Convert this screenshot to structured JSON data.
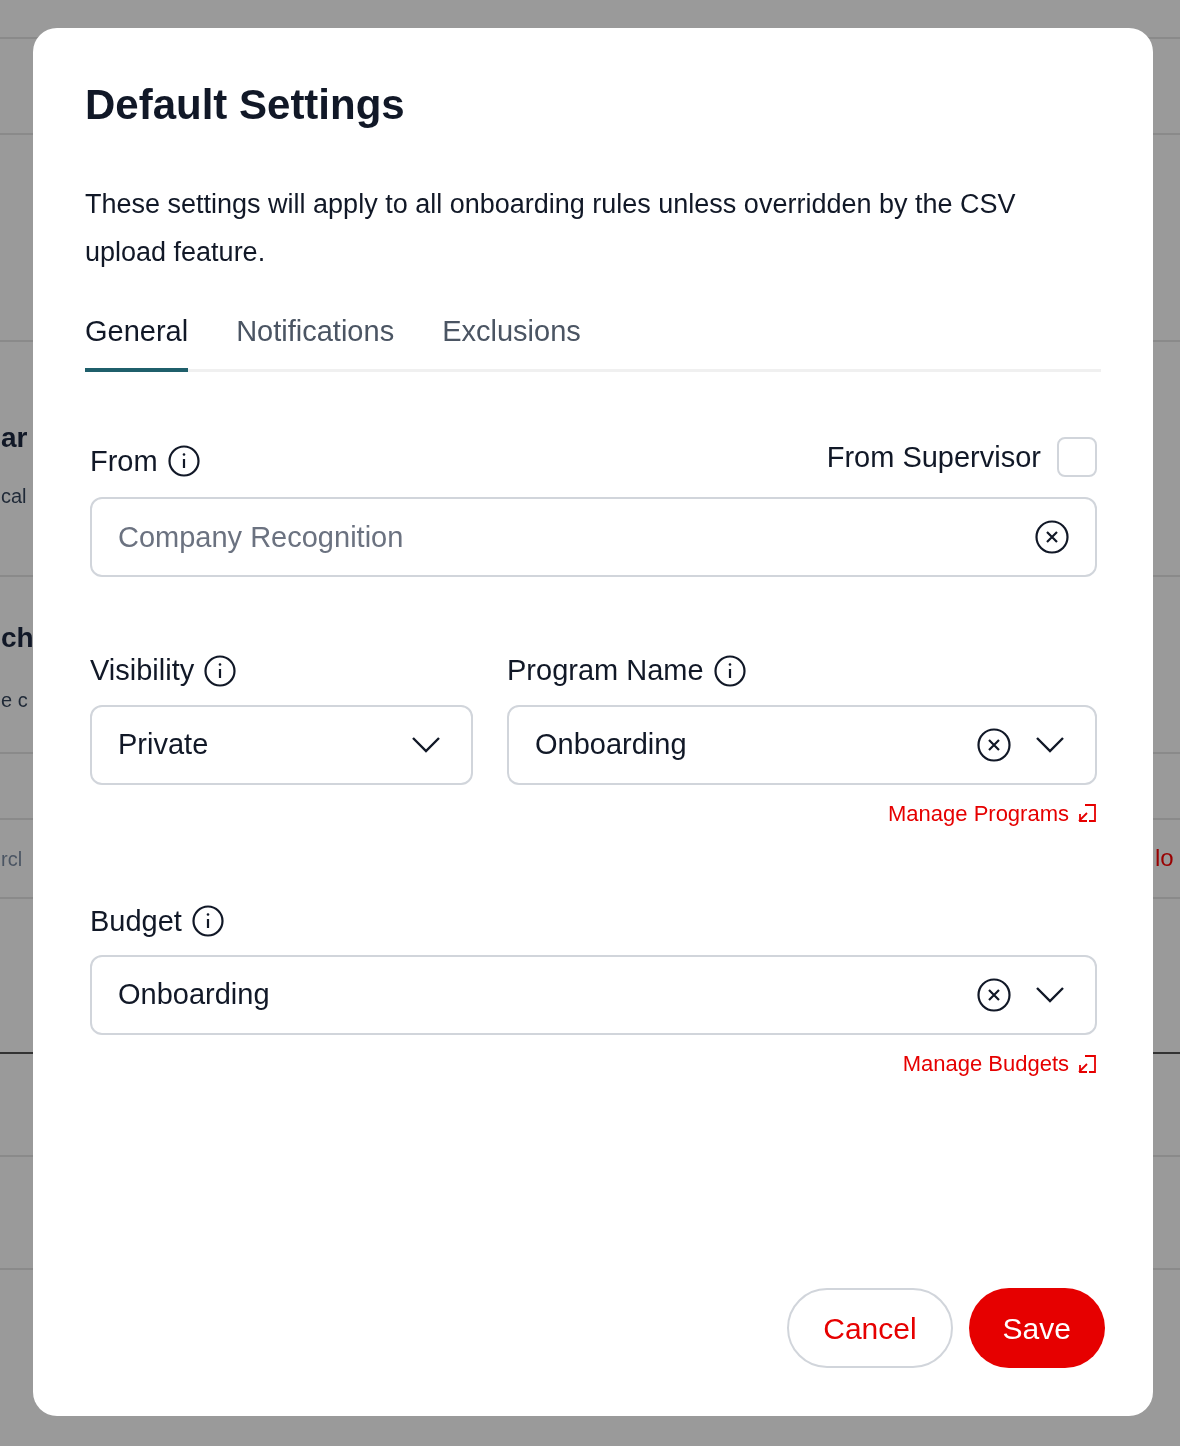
{
  "background": {
    "left_fragments": [
      {
        "text": "ar",
        "kind": "heading"
      },
      {
        "text": "cal",
        "kind": "body"
      },
      {
        "text": "ch",
        "kind": "heading"
      },
      {
        "text": "e c",
        "kind": "body"
      },
      {
        "text": "rcl",
        "kind": "muted"
      }
    ],
    "right_fragments": [
      {
        "text": "lo",
        "kind": "link"
      }
    ]
  },
  "dialog": {
    "title": "Default Settings",
    "description": "These settings will apply to all onboarding rules unless overridden by the CSV upload feature.",
    "tabs": [
      {
        "label": "General",
        "selected": true
      },
      {
        "label": "Notifications",
        "selected": false
      },
      {
        "label": "Exclusions",
        "selected": false
      }
    ],
    "from": {
      "label": "From",
      "placeholder": "Company Recognition",
      "from_supervisor": {
        "label": "From Supervisor",
        "checked": false
      }
    },
    "visibility": {
      "label": "Visibility",
      "value": "Private"
    },
    "program_name": {
      "label": "Program Name",
      "value": "Onboarding",
      "link": "Manage Programs"
    },
    "budget": {
      "label": "Budget",
      "value": "Onboarding",
      "link": "Manage Budgets"
    },
    "buttons": [
      {
        "label": "Cancel",
        "kind": "secondary"
      },
      {
        "label": "Save",
        "kind": "primary"
      }
    ]
  }
}
